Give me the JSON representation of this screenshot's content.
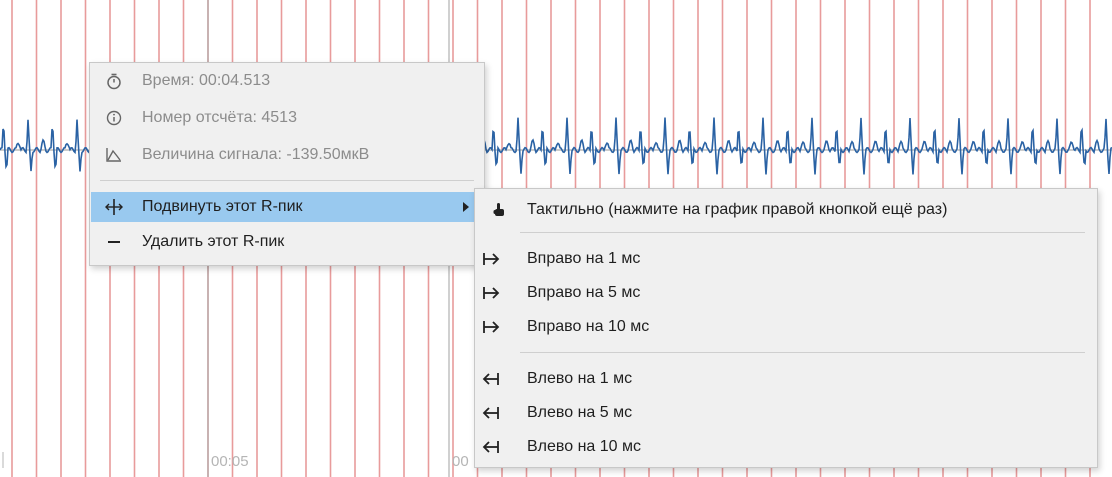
{
  "chart": {
    "time_ticks": [
      "00:05",
      "00"
    ]
  },
  "context_menu": {
    "info": {
      "time_label": "Время: 00:04.513",
      "sample_label": "Номер отсчёта: 4513",
      "signal_label": "Величина сигнала:  -139.50мкВ"
    },
    "move_peak_label": "Подвинуть этот R-пик",
    "delete_peak_label": "Удалить этот R-пик"
  },
  "submenu": {
    "tactile_label": "Тактильно (нажмите на график правой кнопкой ещё раз)",
    "right_1": "Вправо на 1 мс",
    "right_5": "Вправо на 5 мс",
    "right_10": "Вправо на 10 мс",
    "left_1": "Влево на 1 мс",
    "left_5": "Влево на 5 мс",
    "left_10": "Влево на 10 мс"
  },
  "colors": {
    "signal": "#2a62a4",
    "r_peak_marker": "#e89b9b",
    "highlight": "#99c9ef",
    "menu_bg": "#f0f0f0"
  }
}
